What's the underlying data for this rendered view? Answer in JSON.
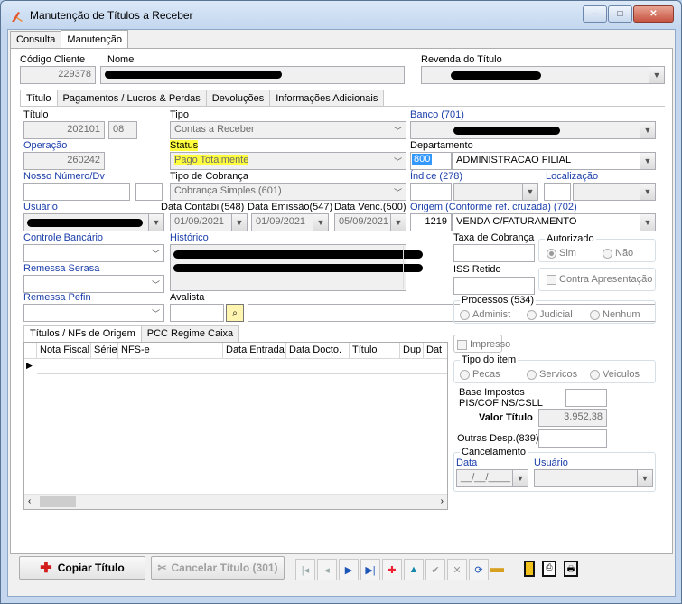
{
  "window": {
    "title": "Manutenção de Títulos a Receber",
    "min": "–",
    "max": "□",
    "close": "✕"
  },
  "main_tabs": [
    "Consulta",
    "Manutenção"
  ],
  "header": {
    "codigo_cliente_label": "Código Cliente",
    "codigo_cliente": "229378",
    "nome_label": "Nome",
    "revenda_label": "Revenda do Título"
  },
  "inner_tabs": [
    "Título",
    "Pagamentos / Lucros & Perdas",
    "Devoluções",
    "Informações Adicionais"
  ],
  "form": {
    "titulo_label": "Título",
    "titulo": "202101",
    "titulo_parcela": "08",
    "tipo_label": "Tipo",
    "tipo": "Contas a Receber",
    "banco_label": "Banco (701)",
    "operacao_label": "Operação",
    "operacao": "260242",
    "status_label": "Status",
    "status": "Pago Totalmente",
    "departamento_label": "Departamento",
    "departamento_code": "800",
    "departamento": "ADMINISTRACAO FILIAL",
    "nosso_numero_label": "Nosso Número/Dv",
    "tipo_cobranca_label": "Tipo de Cobrança",
    "tipo_cobranca": "Cobrança Simples (601)",
    "indice_label": "Índice (278)",
    "localizacao_label": "Localização",
    "usuario_label": "Usuário",
    "data_contabil_label": "Data Contábil(548)",
    "data_contabil": "01/09/2021",
    "data_emissao_label": "Data Emissão(547)",
    "data_emissao": "01/09/2021",
    "data_venc_label": "Data Venc.(500)",
    "data_venc": "05/09/2021",
    "origem_label": "Origem (Conforme ref. cruzada) (702)",
    "origem_code": "1219",
    "origem": "VENDA C/FATURAMENTO",
    "controle_bancario_label": "Controle Bancário",
    "historico_label": "Histórico",
    "taxa_cobranca_label": "Taxa de Cobrança",
    "autorizado_label": "Autorizado",
    "autorizado_sim": "Sim",
    "autorizado_nao": "Não",
    "remessa_serasa_label": "Remessa Serasa",
    "iss_retido_label": "ISS Retido",
    "contra_apresentacao": "Contra Apresentação",
    "remessa_pefin_label": "Remessa Pefin",
    "avalista_label": "Avalista",
    "processos_label": "Processos (534)",
    "proc_admin": "Administ",
    "proc_judicial": "Judicial",
    "proc_nenhum": "Nenhum",
    "impresso": "Impresso",
    "tipo_item_label": "Tipo do item",
    "item_pecas": "Pecas",
    "item_servicos": "Servicos",
    "item_veiculos": "Veiculos",
    "base_impostos_label_1": "Base Impostos",
    "base_impostos_label_2": "PIS/COFINS/CSLL",
    "valor_titulo_label": "Valor Título",
    "valor_titulo": "3.952,38",
    "outras_desp_label": "Outras Desp.(839)",
    "cancelamento_label": "Cancelamento",
    "cancel_data_label": "Data",
    "cancel_usuario_label": "Usuário",
    "cancel_data": "__/__/____"
  },
  "sub_tabs": [
    "Títulos / NFs de Origem",
    "PCC Regime Caixa"
  ],
  "grid_columns": [
    "Nota Fiscal",
    "Série",
    "NFS-e",
    "Data Entrada",
    "Data Docto.",
    "Título",
    "Dup",
    "Dat"
  ],
  "toolbar": {
    "copiar": "Copiar Título",
    "cancelar": "Cancelar Título (301)"
  },
  "colors": {
    "label_blue": "#1a3eaa",
    "highlight": "#ffff3e",
    "dept_selected": "#3399ff"
  }
}
